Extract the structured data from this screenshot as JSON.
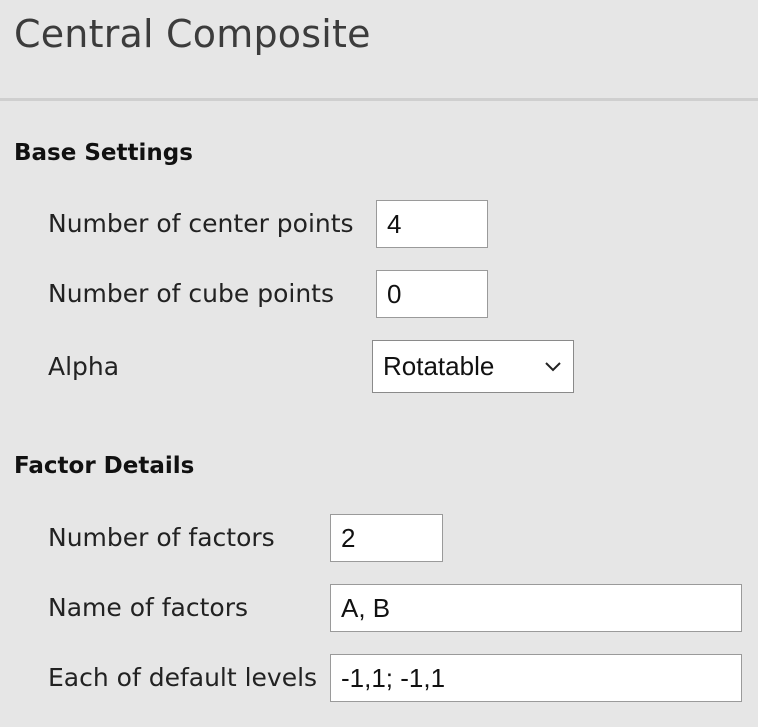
{
  "page": {
    "title": "Central Composite"
  },
  "base_settings": {
    "heading": "Base Settings",
    "center_points": {
      "label": "Number of center points",
      "value": "4"
    },
    "cube_points": {
      "label": "Number of cube points",
      "value": "0"
    },
    "alpha": {
      "label": "Alpha",
      "selected": "Rotatable",
      "icon": "chevron-down-icon"
    }
  },
  "factor_details": {
    "heading": "Factor Details",
    "num_factors": {
      "label": "Number of factors",
      "value": "2"
    },
    "factor_names": {
      "label": "Name of factors",
      "value": "A, B"
    },
    "default_levels": {
      "label": "Each of default levels",
      "value": "-1,1; -1,1"
    }
  }
}
